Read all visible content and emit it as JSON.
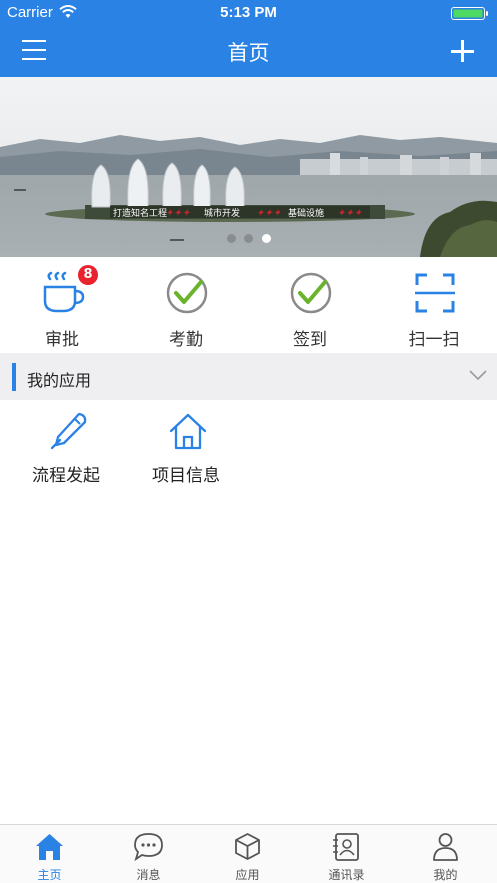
{
  "status_bar": {
    "carrier": "Carrier",
    "time": "5:13 PM"
  },
  "nav": {
    "title": "首页"
  },
  "banner": {
    "caption_left": "打造知名工程",
    "caption_mid": "城市开发",
    "caption_right": "基础设施",
    "dots_count": 3,
    "active_dot": 2
  },
  "quick_actions": [
    {
      "label": "审批",
      "icon": "coffee-cup-icon",
      "badge": "8"
    },
    {
      "label": "考勤",
      "icon": "check-circle-icon"
    },
    {
      "label": "签到",
      "icon": "check-circle-icon"
    },
    {
      "label": "扫一扫",
      "icon": "scan-icon"
    }
  ],
  "section": {
    "title": "我的应用"
  },
  "apps": [
    {
      "label": "流程发起",
      "icon": "pen-icon"
    },
    {
      "label": "项目信息",
      "icon": "house-icon"
    }
  ],
  "tabs": [
    {
      "label": "主页",
      "icon": "home-icon",
      "active": true
    },
    {
      "label": "消息",
      "icon": "chat-bubble-icon"
    },
    {
      "label": "应用",
      "icon": "cube-icon"
    },
    {
      "label": "通讯录",
      "icon": "contacts-icon"
    },
    {
      "label": "我的",
      "icon": "person-icon"
    }
  ],
  "colors": {
    "accent": "#2a82e4",
    "badge": "#e8232b",
    "check": "#6ab42d",
    "section_bg": "#efeff1"
  }
}
